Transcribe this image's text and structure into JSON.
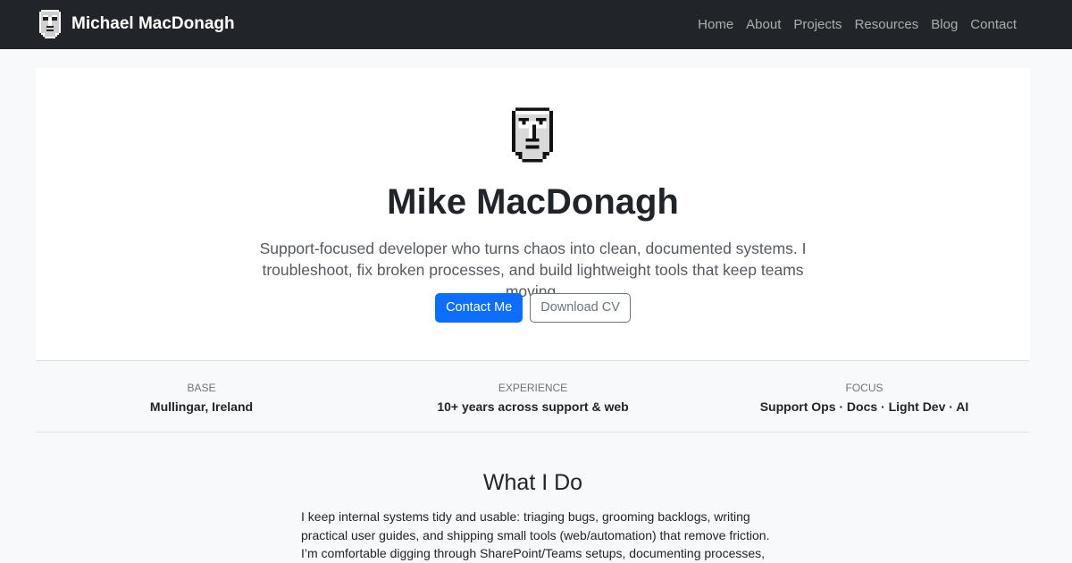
{
  "navbar": {
    "brand": "Michael MacDonagh",
    "links": [
      "Home",
      "About",
      "Projects",
      "Resources",
      "Blog",
      "Contact"
    ]
  },
  "hero": {
    "title": "Mike MacDonagh",
    "lead": "Support-focused developer who turns chaos into clean, documented systems. I troubleshoot, fix broken processes, and build lightweight tools that keep teams moving.",
    "primary_button": "Contact Me",
    "secondary_button": "Download CV"
  },
  "stats": [
    {
      "label": "BASE",
      "value": "Mullingar, Ireland"
    },
    {
      "label": "EXPERIENCE",
      "value": "10+ years across support & web"
    },
    {
      "label": "FOCUS",
      "value": "Support Ops · Docs · Light Dev · AI"
    }
  ],
  "what_i_do": {
    "title": "What I Do",
    "body": "I keep internal systems tidy and usable: triaging bugs, grooming backlogs, writing practical user guides, and shipping small tools (web/automation) that remove friction. I’m comfortable digging through SharePoint/Teams setups, documenting processes,"
  },
  "colors": {
    "navbar_bg": "#212529",
    "primary": "#0d6efd",
    "page_bg": "#f8f9fa"
  },
  "icons": {
    "brand_logo": "pixel-face-icon",
    "hero_logo": "pixel-face-icon"
  }
}
